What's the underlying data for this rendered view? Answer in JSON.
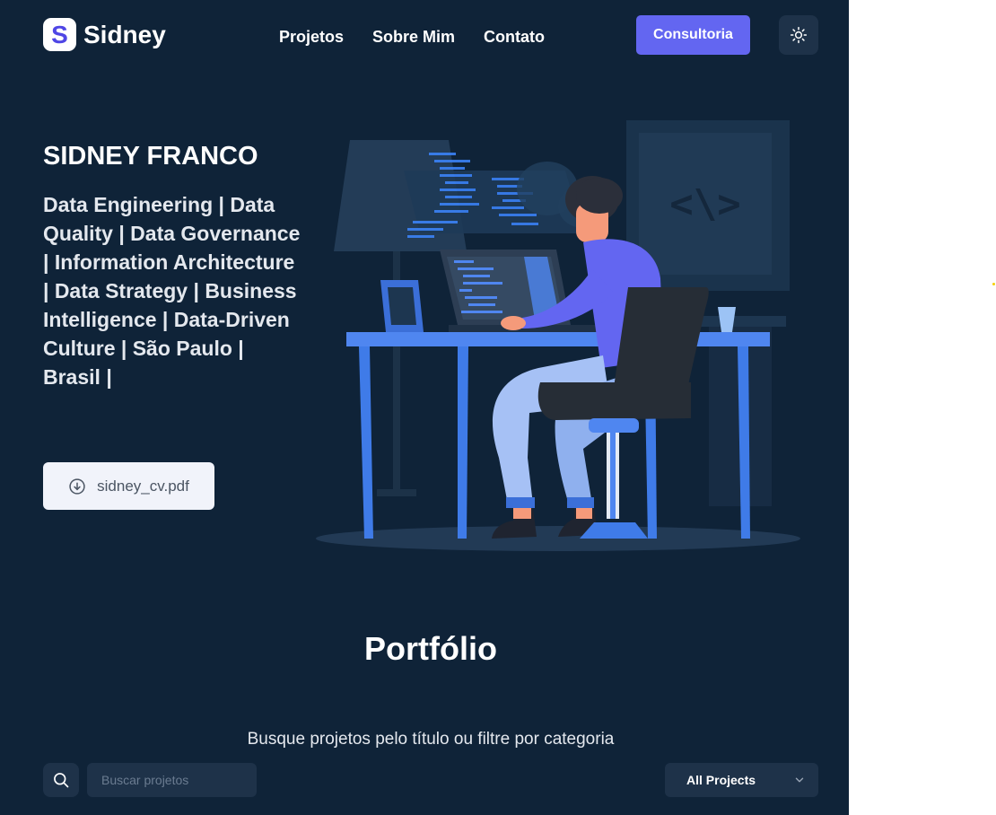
{
  "brand": {
    "logo_letter": "S",
    "name": "Sidney"
  },
  "nav": {
    "items": [
      "Projetos",
      "Sobre Mim",
      "Contato"
    ]
  },
  "header": {
    "cta_label": "Consultoria"
  },
  "hero": {
    "name": "SIDNEY FRANCO",
    "description": "Data Engineering | Data Quality | Data Governance | Information Architecture | Data Strategy | Business Intelligence | Data-Driven Culture | São Paulo | Brasil |",
    "cv_label": "sidney_cv.pdf"
  },
  "portfolio": {
    "title": "Portfólio",
    "subtitle": "Busque projetos pelo título ou filtre por categoria",
    "search_placeholder": "Buscar projetos",
    "filter_selected": "All Projects"
  },
  "colors": {
    "background": "#0f2338",
    "accent": "#6366f1",
    "surface": "#1e3249"
  },
  "icons": {
    "theme_toggle": "sun-icon",
    "cv": "download-circle-icon",
    "search": "search-icon",
    "select": "chevron-down-icon"
  }
}
